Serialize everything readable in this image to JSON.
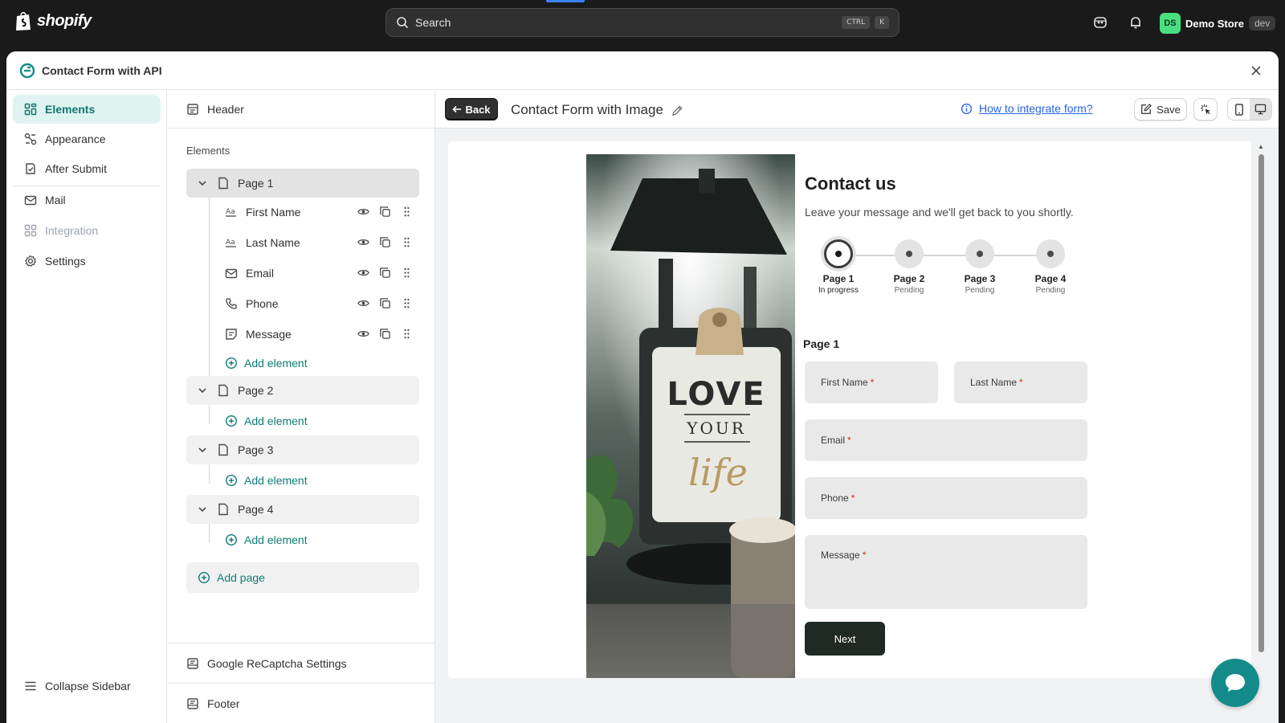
{
  "topbar": {
    "logo_text": "shopify",
    "search_placeholder": "Search",
    "shortcut_ctrl": "CTRL",
    "shortcut_key": "K",
    "store_initials": "DS",
    "store_name": "Demo Store",
    "store_badge": "dev",
    "accent_color": "#4ade80"
  },
  "modal": {
    "title": "Contact Form with API"
  },
  "nav": {
    "items": [
      {
        "label": "Elements",
        "icon": "elements-icon",
        "active": true
      },
      {
        "label": "Appearance",
        "icon": "appearance-icon"
      },
      {
        "label": "After Submit",
        "icon": "after-submit-icon"
      },
      {
        "label": "Mail",
        "icon": "mail-icon"
      },
      {
        "label": "Integration",
        "icon": "integration-icon",
        "disabled": true
      },
      {
        "label": "Settings",
        "icon": "gear-icon"
      }
    ],
    "collapse_label": "Collapse Sidebar"
  },
  "tree": {
    "header_label": "Header",
    "section_label": "Elements",
    "pages": [
      {
        "label": "Page 1",
        "fields": [
          "First Name",
          "Last Name",
          "Email",
          "Phone",
          "Message"
        ]
      },
      {
        "label": "Page 2",
        "fields": []
      },
      {
        "label": "Page 3",
        "fields": []
      },
      {
        "label": "Page 4",
        "fields": []
      }
    ],
    "add_element_label": "Add element",
    "add_page_label": "Add page",
    "recaptcha_label": "Google ReCaptcha Settings",
    "footer_label": "Footer"
  },
  "editor": {
    "back_label": "Back",
    "form_title": "Contact Form with Image",
    "help_link": "How to integrate form?",
    "save_label": "Save"
  },
  "form": {
    "heading": "Contact us",
    "subheading": "Leave your message and we'll get back to you shortly.",
    "steps": [
      {
        "label": "Page 1",
        "status": "In progress"
      },
      {
        "label": "Page 2",
        "status": "Pending"
      },
      {
        "label": "Page 3",
        "status": "Pending"
      },
      {
        "label": "Page 4",
        "status": "Pending"
      }
    ],
    "current_page": "Page 1",
    "fields": {
      "first_name": "First Name",
      "last_name": "Last Name",
      "email": "Email",
      "phone": "Phone",
      "message": "Message"
    },
    "required_mark": "*",
    "next_label": "Next",
    "image_text": {
      "line1": "LOVE",
      "line2": "YOUR",
      "line3": "life"
    }
  }
}
